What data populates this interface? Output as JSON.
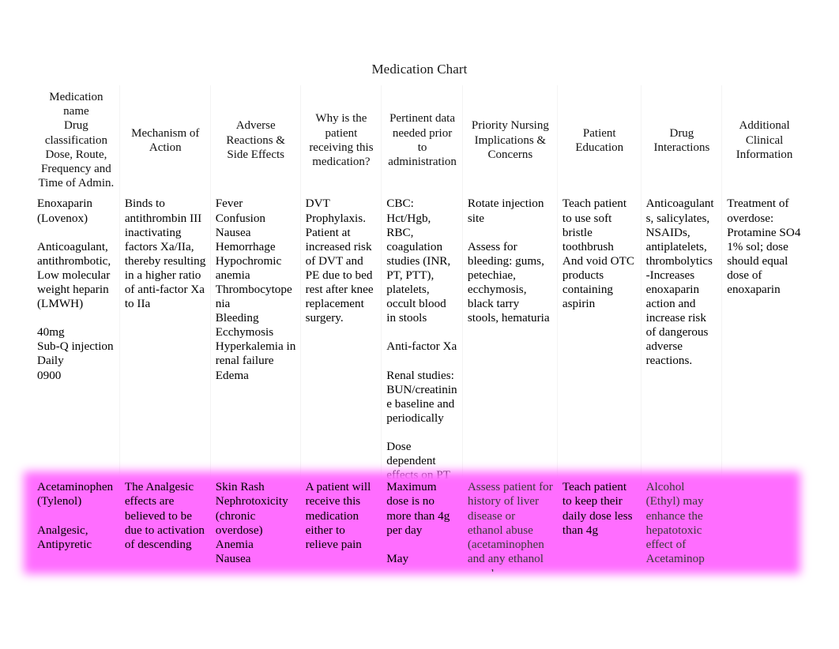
{
  "document": {
    "title": "Medication Chart"
  },
  "table": {
    "headers": [
      "Medication name\nDrug classification\nDose, Route, Frequency and Time of Admin.",
      "Mechanism of Action",
      "Adverse Reactions & Side Effects",
      "Why is the patient receiving this medication?",
      "Pertinent data needed prior to administration",
      "Priority Nursing Implications & Concerns",
      "Patient Education",
      "Drug Interactions",
      "Additional Clinical Information"
    ],
    "rows": [
      {
        "highlighted": false,
        "cells": [
          "Enoxaparin (Lovenox)\n\nAnticoagulant, antithrombotic, Low molecular weight heparin (LMWH)\n\n40mg\nSub-Q injection\nDaily\n0900",
          "Binds to antithrombin III inactivating factors Xa/IIa, thereby resulting in a higher ratio of anti-factor Xa to IIa",
          "Fever\nConfusion\nNausea\nHemorrhage\nHypochromic anemia\nThrombocytopenia\nBleeding\nEcchymosis\nHyperkalemia in renal failure\nEdema",
          "DVT Prophylaxis. Patient at increased risk of DVT and PE due to bed rest after knee replacement surgery.",
          "CBC: Hct/Hgb, RBC, coagulation studies (INR, PT, PTT), platelets, occult blood in stools\n\nAnti-factor Xa\n\nRenal studies: BUN/creatinine baseline and periodically\n\nDose dependent effects on PT and aPTT",
          "Rotate injection site\n\nAssess for bleeding: gums, petechiae, ecchymosis, black tarry stools, hematuria",
          "Teach patient to use soft bristle toothbrush And void OTC products containing aspirin",
          "Anticoagulants, salicylates, NSAIDs, antiplatelets, thrombolytics -Increases enoxaparin action and increase risk of dangerous adverse reactions.",
          "Treatment of overdose: Protamine SO4 1% sol; dose should equal dose of enoxaparin"
        ]
      },
      {
        "highlighted": true,
        "cells": [
          "Acetaminophen (Tylenol)\n\nAnalgesic, Antipyretic",
          "The Analgesic effects are believed to be due to activation of descending",
          "Skin Rash\nNephrotoxicity (chronic overdose)\nAnemia\nNausea",
          "A patient will receive this medication either to relieve pain",
          "Maximum dose is no more than 4g per day\n\nMay",
          "Assess patient for history of liver disease or ethanol abuse (acetaminophen and any ethanol may have",
          "Teach patient to keep their daily dose less than 4g",
          "Alcohol (Ethyl) may enhance the hepatotoxic effect of Acetaminop",
          ""
        ]
      }
    ],
    "highlight_color": "#ff6dff"
  }
}
